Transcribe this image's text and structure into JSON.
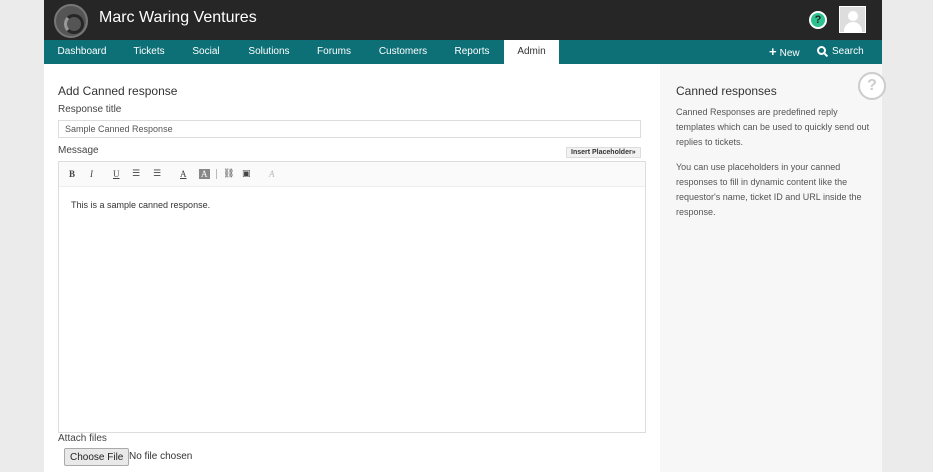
{
  "header": {
    "brand": "Marc Waring Ventures",
    "help_icon": "?"
  },
  "nav": {
    "tabs": [
      {
        "label": "Dashboard"
      },
      {
        "label": "Tickets"
      },
      {
        "label": "Social"
      },
      {
        "label": "Solutions"
      },
      {
        "label": "Forums"
      },
      {
        "label": "Customers"
      },
      {
        "label": "Reports"
      },
      {
        "label": "Admin",
        "active": true
      }
    ],
    "new_label": "New",
    "search_label": "Search"
  },
  "form": {
    "heading": "Add Canned response",
    "title_label": "Response title",
    "title_value": "Sample Canned Response",
    "message_label": "Message",
    "insert_placeholder_label": "Insert Placeholder»",
    "editor_content": "This is a sample canned response.",
    "toolbar": {
      "bold": "B",
      "italic": "I",
      "underline": "U",
      "font_color": "A",
      "bg_color": "A",
      "remove_format": "A"
    },
    "attach_label": "Attach files",
    "choose_file_label": "Choose File",
    "file_status": "No file chosen"
  },
  "sidebar": {
    "heading": "Canned responses",
    "paragraph1": "Canned Responses are predefined reply templates which can be used to quickly send out replies to tickets.",
    "paragraph2": "You can use placeholders in your canned responses to fill in dynamic content like the requestor's name, ticket ID and URL inside the response.",
    "help_icon": "?"
  },
  "colors": {
    "topbar": "#262626",
    "navbar": "#0d7077",
    "help_icon": "#2cc18e"
  }
}
